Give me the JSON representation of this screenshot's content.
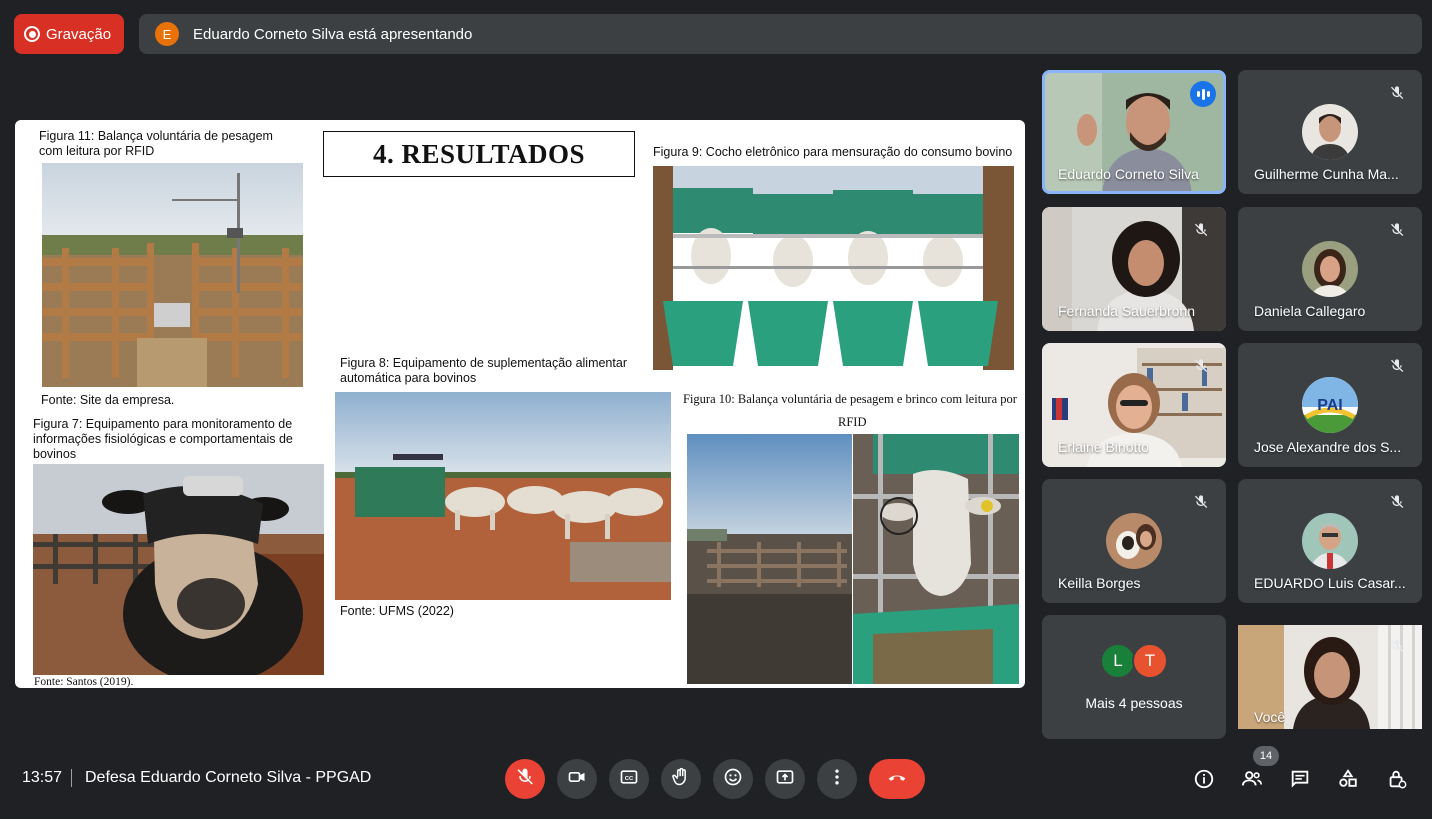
{
  "recording": {
    "label": "Gravação",
    "color": "#d93025"
  },
  "presenting": {
    "avatar_letter": "E",
    "text": "Eduardo Corneto Silva está apresentando"
  },
  "slide": {
    "title": "4. RESULTADOS",
    "fig11_caption": "Figura 11: Balança voluntária de pesagem com leitura por RFID",
    "fig11_source": "Fonte: Site da empresa.",
    "fig7_caption": "Figura 7: Equipamento para monitoramento de informações fisiológicas e comportamentais de bovinos",
    "fig7_source": "Fonte: Santos (2019).",
    "fig8_caption": "Figura 8: Equipamento de suplementação alimentar automática para bovinos",
    "fig8_source": "Fonte: UFMS (2022)",
    "fig9_caption": "Figura 9: Cocho eletrônico para mensuração do consumo bovino",
    "fig10_caption_line1": "Figura 10: Balança voluntária de pesagem e brinco com leitura por",
    "fig10_caption_line2": "RFID"
  },
  "participants": [
    {
      "name": "Eduardo Corneto Silva",
      "speaking": true
    },
    {
      "name": "Guilherme Cunha Ma...",
      "muted": true
    },
    {
      "name": "Fernanda Sauerbronn",
      "muted": true
    },
    {
      "name": "Daniela Callegaro",
      "muted": true
    },
    {
      "name": "Erlaine Binotto",
      "muted": true
    },
    {
      "name": "Jose Alexandre dos S...",
      "muted": true
    },
    {
      "name": "Keilla Borges",
      "muted": true
    },
    {
      "name": "EDUARDO Luis Casar...",
      "muted": true
    },
    {
      "more_label": "Mais 4 pessoas",
      "letters": [
        "L",
        "T"
      ]
    },
    {
      "name": "Você",
      "muted": true
    }
  ],
  "bottom": {
    "time": "13:57",
    "meeting_title": "Defesa Eduardo Corneto Silva - PPGAD",
    "people_count": "14"
  },
  "icons": [
    "mic-off-icon",
    "camera-icon",
    "captions-icon",
    "raise-hand-icon",
    "emoji-icon",
    "present-icon",
    "more-icon",
    "end-call-icon",
    "info-icon",
    "people-icon",
    "chat-icon",
    "activities-icon",
    "host-controls-icon"
  ]
}
